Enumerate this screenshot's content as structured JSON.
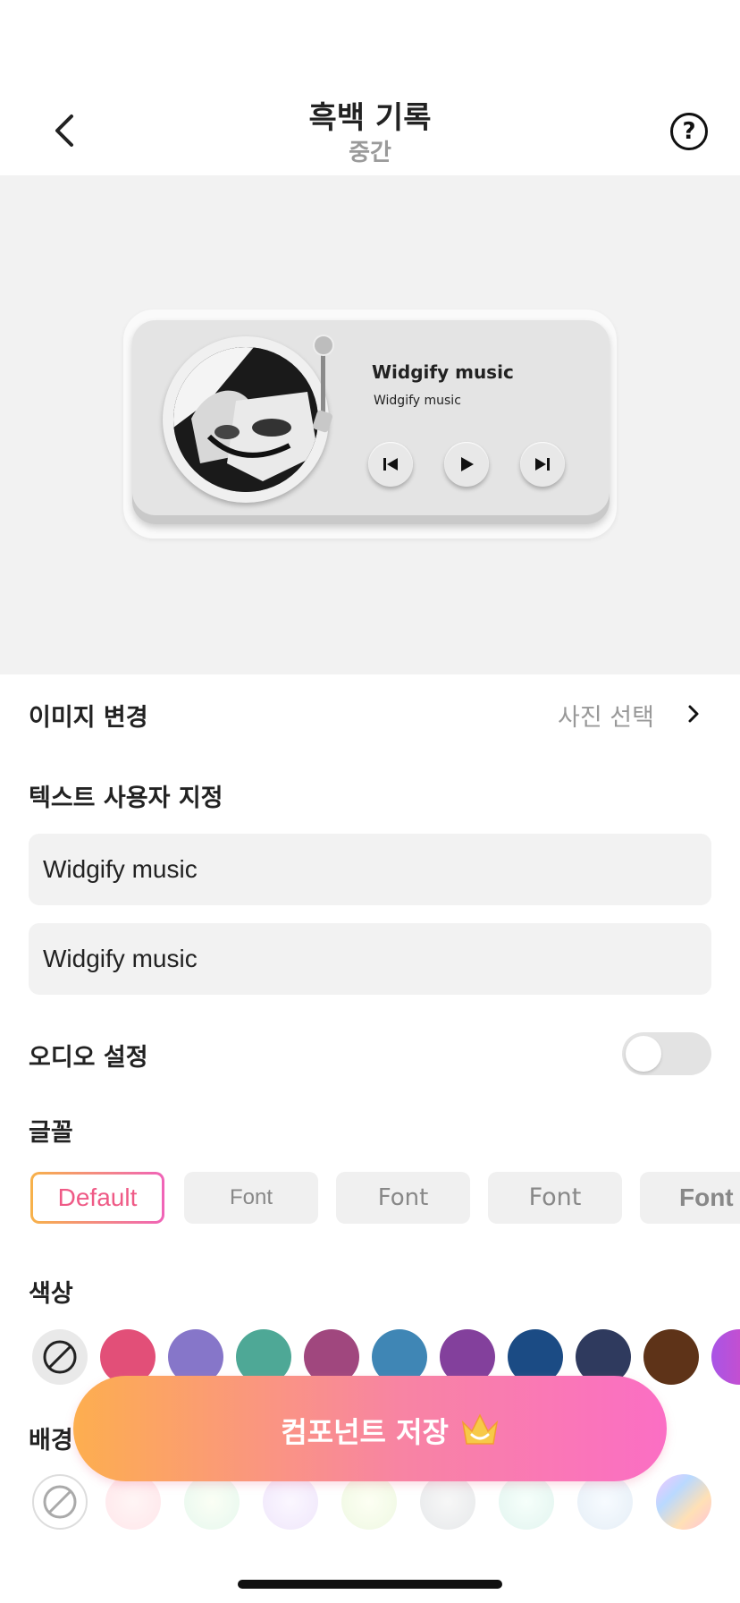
{
  "header": {
    "title": "흑백 기록",
    "subtitle": "중간",
    "help_glyph": "?"
  },
  "widget": {
    "title": "Widgify music",
    "subtitle": "Widgify music",
    "controls": [
      "previous-icon",
      "play-icon",
      "next-icon"
    ]
  },
  "image_row": {
    "label": "이미지 변경",
    "action": "사진 선택"
  },
  "text_section": {
    "label": "텍스트 사용자 지정",
    "field1_value": "Widgify music",
    "field2_value": "Widgify music"
  },
  "audio": {
    "label": "오디오 설정",
    "enabled": false
  },
  "font_section": {
    "label": "글꼴",
    "options": [
      "Default",
      "Font",
      "Font",
      "Font",
      "Font"
    ],
    "selected": "Default"
  },
  "color_section": {
    "label": "색상",
    "swatches": [
      "none",
      "#e24f78",
      "#8676c9",
      "#4ea896",
      "#a0477e",
      "#3f86b5",
      "#83409c",
      "#1b4b84",
      "#2f3a5e",
      "#5e3318",
      "#a855e6"
    ]
  },
  "background_section": {
    "label": "배경"
  },
  "save_button": {
    "label": "컴포넌트 저장"
  },
  "colors": {
    "accent_gradient_start": "#fdae4f",
    "accent_gradient_end": "#fb6ec4",
    "selected_font_text": "#ef5a86"
  }
}
